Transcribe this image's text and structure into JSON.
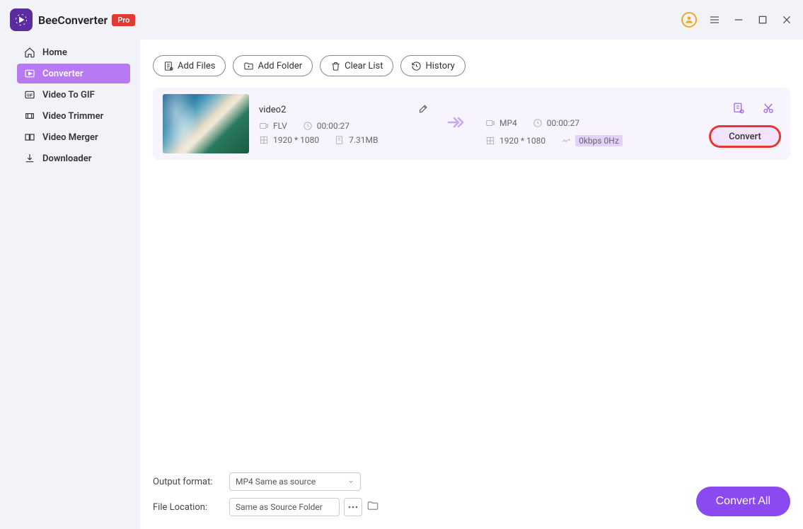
{
  "app": {
    "name": "BeeConverter",
    "badge": "Pro"
  },
  "sidebar": {
    "items": [
      {
        "label": "Home"
      },
      {
        "label": "Converter"
      },
      {
        "label": "Video To GIF"
      },
      {
        "label": "Video Trimmer"
      },
      {
        "label": "Video Merger"
      },
      {
        "label": "Downloader"
      }
    ]
  },
  "toolbar": {
    "add_files": "Add Files",
    "add_folder": "Add Folder",
    "clear_list": "Clear List",
    "history": "History"
  },
  "file": {
    "name": "video2",
    "src": {
      "format": "FLV",
      "duration": "00:00:27",
      "resolution": "1920 * 1080",
      "size": "7.31MB"
    },
    "dst": {
      "format": "MP4",
      "duration": "00:00:27",
      "resolution": "1920 * 1080",
      "audio": "0kbps 0Hz"
    },
    "convert_label": "Convert"
  },
  "footer": {
    "output_format_label": "Output format:",
    "output_format_value": "MP4 Same as source",
    "file_location_label": "File Location:",
    "file_location_value": "Same as Source Folder",
    "convert_all": "Convert All"
  }
}
